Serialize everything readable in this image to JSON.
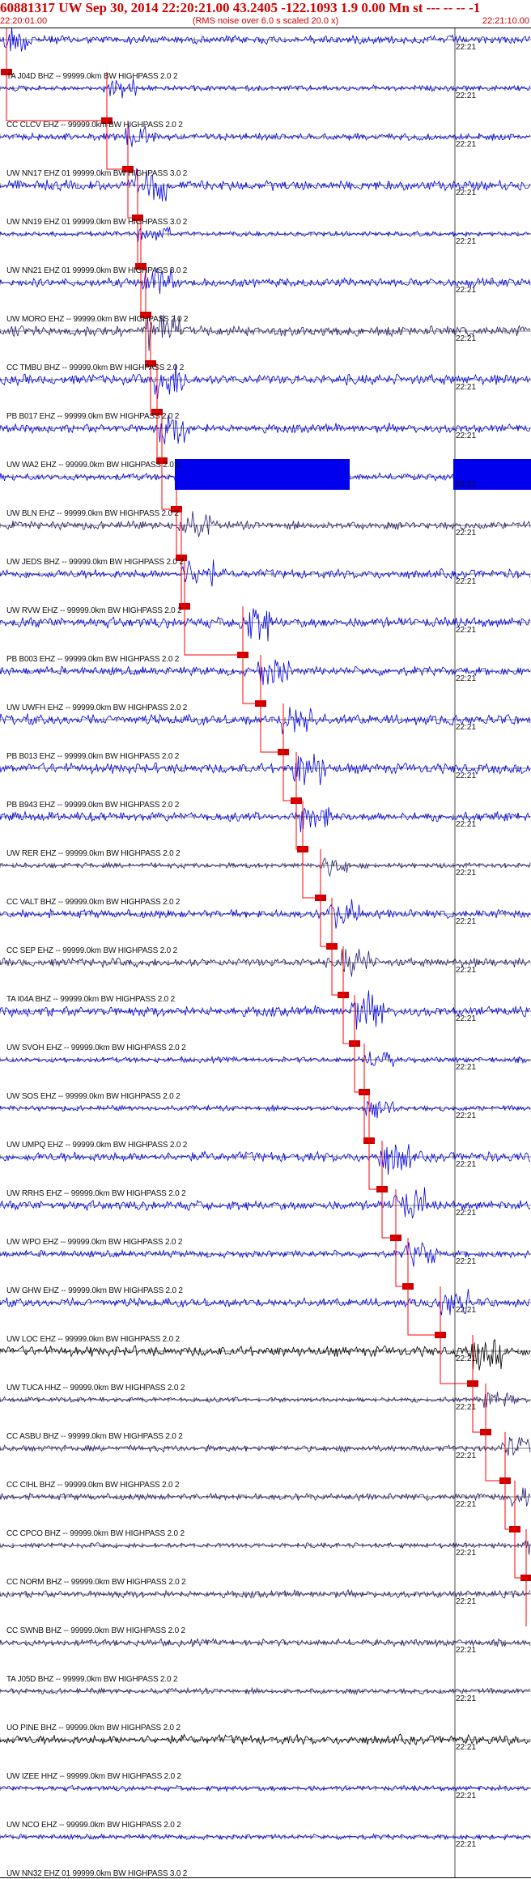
{
  "header": {
    "title": "60881317 UW Sep 30, 2014 22:20:21.00   43.2405 -122.1093  1.9 0.00 Mn st --- -- --  -1",
    "time_left": "22:20:01.00",
    "subtitle": "(RMS noise over 6.0 s scaled 20.0 x)",
    "time_right": "22:21:10.00"
  },
  "minute_mark": "22:21",
  "traces": [
    {
      "label": "TA J04D BHZ -- 99999.0km BW  HIGHPASS  2.0  2",
      "color": "#0000ee"
    },
    {
      "label": "CC CLCV EHZ -- 99999.0km BW  HIGHPASS  2.0  2",
      "color": "#0000ee"
    },
    {
      "label": "UW NN17 EHZ 01 99999.0km BW  HIGHPASS  3.0  2",
      "color": "#0000ee"
    },
    {
      "label": "UW NN19 EHZ 01 99999.0km BW  HIGHPASS  3.0  2",
      "color": "#0000ee"
    },
    {
      "label": "UW NN21 EHZ 01 99999.0km BW  HIGHPASS  3.0  2",
      "color": "#0000ee"
    },
    {
      "label": "UW MORO EHZ -- 99999.0km BW  HIGHPASS  2.0  2",
      "color": "#0000ee"
    },
    {
      "label": "CC TMBU BHZ -- 99999.0km BW  HIGHPASS  2.0  2",
      "color": "#2a1f6e"
    },
    {
      "label": "PB B017 EHZ -- 99999.0km BW  HIGHPASS  2.0  2",
      "color": "#0000ee"
    },
    {
      "label": "UW WA2 EHZ -- 99999.0km BW  HIGHPASS  2.0  2",
      "color": "#0000ee"
    },
    {
      "label": "UW BLN EHZ -- 99999.0km BW  HIGHPASS  2.0  2",
      "color": "#0000ee"
    },
    {
      "label": "UW JEDS BHZ -- 99999.0km BW  HIGHPASS  2.0  2",
      "color": "#2a1f6e"
    },
    {
      "label": "UW RVW EHZ -- 99999.0km BW  HIGHPASS  2.0  2",
      "color": "#0000ee"
    },
    {
      "label": "PB B003 EHZ -- 99999.0km BW  HIGHPASS  2.0  2",
      "color": "#0000ee"
    },
    {
      "label": "UW UWFH EHZ -- 99999.0km BW  HIGHPASS  2.0  2",
      "color": "#0000ee"
    },
    {
      "label": "PB B013 EHZ -- 99999.0km BW  HIGHPASS  2.0  2",
      "color": "#0000ee"
    },
    {
      "label": "PB B943 EHZ -- 99999.0km BW  HIGHPASS  2.0  2",
      "color": "#0000ee"
    },
    {
      "label": "UW RER EHZ -- 99999.0km BW  HIGHPASS  2.0  2",
      "color": "#0000ee"
    },
    {
      "label": "CC VALT BHZ -- 99999.0km BW  HIGHPASS  2.0  2",
      "color": "#2a1f6e"
    },
    {
      "label": "CC SEP EHZ -- 99999.0km BW  HIGHPASS  2.0  2",
      "color": "#0000ee"
    },
    {
      "label": "TA I04A BHZ -- 99999.0km BW  HIGHPASS  2.0  2",
      "color": "#2a1f6e"
    },
    {
      "label": "UW SVOH EHZ -- 99999.0km BW  HIGHPASS  2.0  2",
      "color": "#0000ee"
    },
    {
      "label": "UW SOS EHZ -- 99999.0km BW  HIGHPASS  2.0  2",
      "color": "#0000ee"
    },
    {
      "label": "UW UMPQ EHZ -- 99999.0km BW  HIGHPASS  2.0  2",
      "color": "#0000ee"
    },
    {
      "label": "UW RRHS EHZ -- 99999.0km BW  HIGHPASS  2.0  2",
      "color": "#0000ee"
    },
    {
      "label": "UW WPO EHZ -- 99999.0km BW  HIGHPASS  2.0  2",
      "color": "#0000ee"
    },
    {
      "label": "UW GHW EHZ -- 99999.0km BW  HIGHPASS  2.0  2",
      "color": "#0000ee"
    },
    {
      "label": "UW LOC EHZ -- 99999.0km BW  HIGHPASS  2.0  2",
      "color": "#0000ee"
    },
    {
      "label": "UW TUCA HHZ -- 99999.0km BW  HIGHPASS  2.0  2",
      "color": "#000000"
    },
    {
      "label": "CC ASBU BHZ -- 99999.0km BW  HIGHPASS  2.0  2",
      "color": "#2a1f6e"
    },
    {
      "label": "CC CIHL BHZ -- 99999.0km BW  HIGHPASS  2.0  2",
      "color": "#2a1f6e"
    },
    {
      "label": "CC CPCO BHZ -- 99999.0km BW  HIGHPASS  2.0  2",
      "color": "#2a1f6e"
    },
    {
      "label": "CC NORM BHZ -- 99999.0km BW  HIGHPASS  2.0  2",
      "color": "#2a1f6e"
    },
    {
      "label": "CC SWNB BHZ -- 99999.0km BW  HIGHPASS  2.0  2",
      "color": "#2a1f6e"
    },
    {
      "label": "TA J05D BHZ -- 99999.0km BW  HIGHPASS  2.0  2",
      "color": "#2a1f6e"
    },
    {
      "label": "UO PINE BHZ -- 99999.0km BW  HIGHPASS  2.0  2",
      "color": "#2a1f6e"
    },
    {
      "label": "UW IZEE HHZ -- 99999.0km BW  HIGHPASS  2.0  2",
      "color": "#000000"
    },
    {
      "label": "UW NCO EHZ -- 99999.0km BW  HIGHPASS  2.0  2",
      "color": "#0000ee"
    },
    {
      "label": "UW NN32 EHZ 01 99999.0km BW  HIGHPASS  3.0  2",
      "color": "#0000ee"
    }
  ]
}
